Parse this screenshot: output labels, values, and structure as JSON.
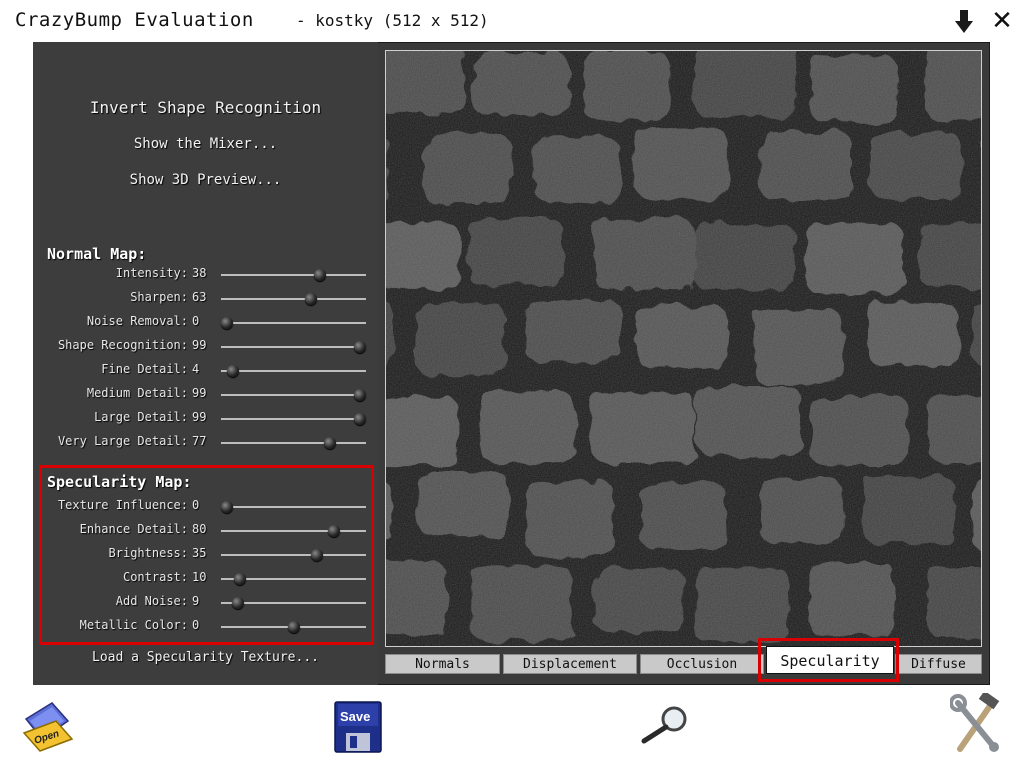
{
  "window": {
    "app_title": "CrazyBump Evaluation",
    "file_title": "- kostky (512 x 512)"
  },
  "left_panel": {
    "invert_shape": "Invert Shape Recognition",
    "show_mixer": "Show the Mixer...",
    "show_3d": "Show 3D Preview...",
    "normal_map": {
      "title": "Normal Map:",
      "sliders": [
        {
          "label": "Intensity:",
          "value": "38",
          "level": 0.68
        },
        {
          "label": "Sharpen:",
          "value": "63",
          "level": 0.62
        },
        {
          "label": "Noise Removal:",
          "value": "0",
          "level": 0.04
        },
        {
          "label": "Shape Recognition:",
          "value": "99",
          "level": 0.96
        },
        {
          "label": "Fine Detail:",
          "value": "4",
          "level": 0.08
        },
        {
          "label": "Medium Detail:",
          "value": "99",
          "level": 0.96
        },
        {
          "label": "Large Detail:",
          "value": "99",
          "level": 0.96
        },
        {
          "label": "Very Large Detail:",
          "value": "77",
          "level": 0.75
        }
      ]
    },
    "specularity_map": {
      "title": "Specularity Map:",
      "sliders": [
        {
          "label": "Texture Influence:",
          "value": "0",
          "level": 0.04
        },
        {
          "label": "Enhance Detail:",
          "value": "80",
          "level": 0.78
        },
        {
          "label": "Brightness:",
          "value": "35",
          "level": 0.66
        },
        {
          "label": "Contrast:",
          "value": "10",
          "level": 0.13
        },
        {
          "label": "Add Noise:",
          "value": "9",
          "level": 0.12
        },
        {
          "label": "Metallic Color:",
          "value": "0",
          "level": 0.5
        }
      ]
    },
    "load_texture": "Load a Specularity Texture..."
  },
  "tabs": [
    {
      "label": "Normals"
    },
    {
      "label": "Displacement"
    },
    {
      "label": "Occlusion"
    },
    {
      "label": "Specularity",
      "active": true
    },
    {
      "label": "Diffuse"
    }
  ],
  "toolbar": {
    "open_label": "Open",
    "save_label": "Save"
  },
  "colors": {
    "highlight": "#d80000",
    "panel": "#3d3d3d"
  }
}
